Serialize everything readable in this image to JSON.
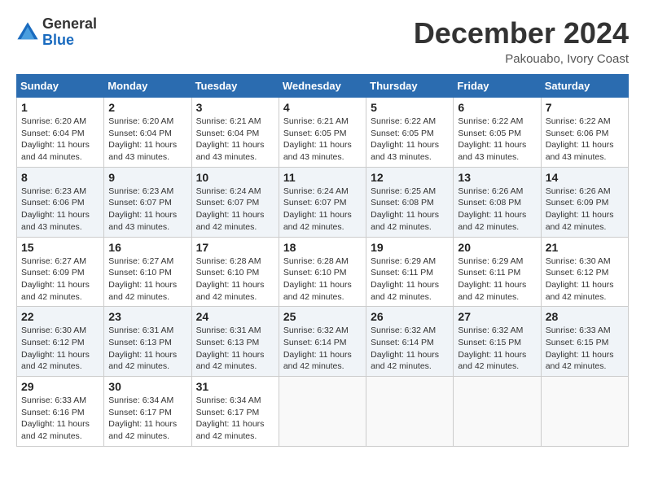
{
  "header": {
    "logo_line1": "General",
    "logo_line2": "Blue",
    "month_title": "December 2024",
    "location": "Pakouabo, Ivory Coast"
  },
  "days_of_week": [
    "Sunday",
    "Monday",
    "Tuesday",
    "Wednesday",
    "Thursday",
    "Friday",
    "Saturday"
  ],
  "weeks": [
    [
      {
        "day": "1",
        "sunrise": "6:20 AM",
        "sunset": "6:04 PM",
        "daylight": "11 hours and 44 minutes."
      },
      {
        "day": "2",
        "sunrise": "6:20 AM",
        "sunset": "6:04 PM",
        "daylight": "11 hours and 43 minutes."
      },
      {
        "day": "3",
        "sunrise": "6:21 AM",
        "sunset": "6:04 PM",
        "daylight": "11 hours and 43 minutes."
      },
      {
        "day": "4",
        "sunrise": "6:21 AM",
        "sunset": "6:05 PM",
        "daylight": "11 hours and 43 minutes."
      },
      {
        "day": "5",
        "sunrise": "6:22 AM",
        "sunset": "6:05 PM",
        "daylight": "11 hours and 43 minutes."
      },
      {
        "day": "6",
        "sunrise": "6:22 AM",
        "sunset": "6:05 PM",
        "daylight": "11 hours and 43 minutes."
      },
      {
        "day": "7",
        "sunrise": "6:22 AM",
        "sunset": "6:06 PM",
        "daylight": "11 hours and 43 minutes."
      }
    ],
    [
      {
        "day": "8",
        "sunrise": "6:23 AM",
        "sunset": "6:06 PM",
        "daylight": "11 hours and 43 minutes."
      },
      {
        "day": "9",
        "sunrise": "6:23 AM",
        "sunset": "6:07 PM",
        "daylight": "11 hours and 43 minutes."
      },
      {
        "day": "10",
        "sunrise": "6:24 AM",
        "sunset": "6:07 PM",
        "daylight": "11 hours and 42 minutes."
      },
      {
        "day": "11",
        "sunrise": "6:24 AM",
        "sunset": "6:07 PM",
        "daylight": "11 hours and 42 minutes."
      },
      {
        "day": "12",
        "sunrise": "6:25 AM",
        "sunset": "6:08 PM",
        "daylight": "11 hours and 42 minutes."
      },
      {
        "day": "13",
        "sunrise": "6:26 AM",
        "sunset": "6:08 PM",
        "daylight": "11 hours and 42 minutes."
      },
      {
        "day": "14",
        "sunrise": "6:26 AM",
        "sunset": "6:09 PM",
        "daylight": "11 hours and 42 minutes."
      }
    ],
    [
      {
        "day": "15",
        "sunrise": "6:27 AM",
        "sunset": "6:09 PM",
        "daylight": "11 hours and 42 minutes."
      },
      {
        "day": "16",
        "sunrise": "6:27 AM",
        "sunset": "6:10 PM",
        "daylight": "11 hours and 42 minutes."
      },
      {
        "day": "17",
        "sunrise": "6:28 AM",
        "sunset": "6:10 PM",
        "daylight": "11 hours and 42 minutes."
      },
      {
        "day": "18",
        "sunrise": "6:28 AM",
        "sunset": "6:10 PM",
        "daylight": "11 hours and 42 minutes."
      },
      {
        "day": "19",
        "sunrise": "6:29 AM",
        "sunset": "6:11 PM",
        "daylight": "11 hours and 42 minutes."
      },
      {
        "day": "20",
        "sunrise": "6:29 AM",
        "sunset": "6:11 PM",
        "daylight": "11 hours and 42 minutes."
      },
      {
        "day": "21",
        "sunrise": "6:30 AM",
        "sunset": "6:12 PM",
        "daylight": "11 hours and 42 minutes."
      }
    ],
    [
      {
        "day": "22",
        "sunrise": "6:30 AM",
        "sunset": "6:12 PM",
        "daylight": "11 hours and 42 minutes."
      },
      {
        "day": "23",
        "sunrise": "6:31 AM",
        "sunset": "6:13 PM",
        "daylight": "11 hours and 42 minutes."
      },
      {
        "day": "24",
        "sunrise": "6:31 AM",
        "sunset": "6:13 PM",
        "daylight": "11 hours and 42 minutes."
      },
      {
        "day": "25",
        "sunrise": "6:32 AM",
        "sunset": "6:14 PM",
        "daylight": "11 hours and 42 minutes."
      },
      {
        "day": "26",
        "sunrise": "6:32 AM",
        "sunset": "6:14 PM",
        "daylight": "11 hours and 42 minutes."
      },
      {
        "day": "27",
        "sunrise": "6:32 AM",
        "sunset": "6:15 PM",
        "daylight": "11 hours and 42 minutes."
      },
      {
        "day": "28",
        "sunrise": "6:33 AM",
        "sunset": "6:15 PM",
        "daylight": "11 hours and 42 minutes."
      }
    ],
    [
      {
        "day": "29",
        "sunrise": "6:33 AM",
        "sunset": "6:16 PM",
        "daylight": "11 hours and 42 minutes."
      },
      {
        "day": "30",
        "sunrise": "6:34 AM",
        "sunset": "6:17 PM",
        "daylight": "11 hours and 42 minutes."
      },
      {
        "day": "31",
        "sunrise": "6:34 AM",
        "sunset": "6:17 PM",
        "daylight": "11 hours and 42 minutes."
      },
      null,
      null,
      null,
      null
    ]
  ]
}
